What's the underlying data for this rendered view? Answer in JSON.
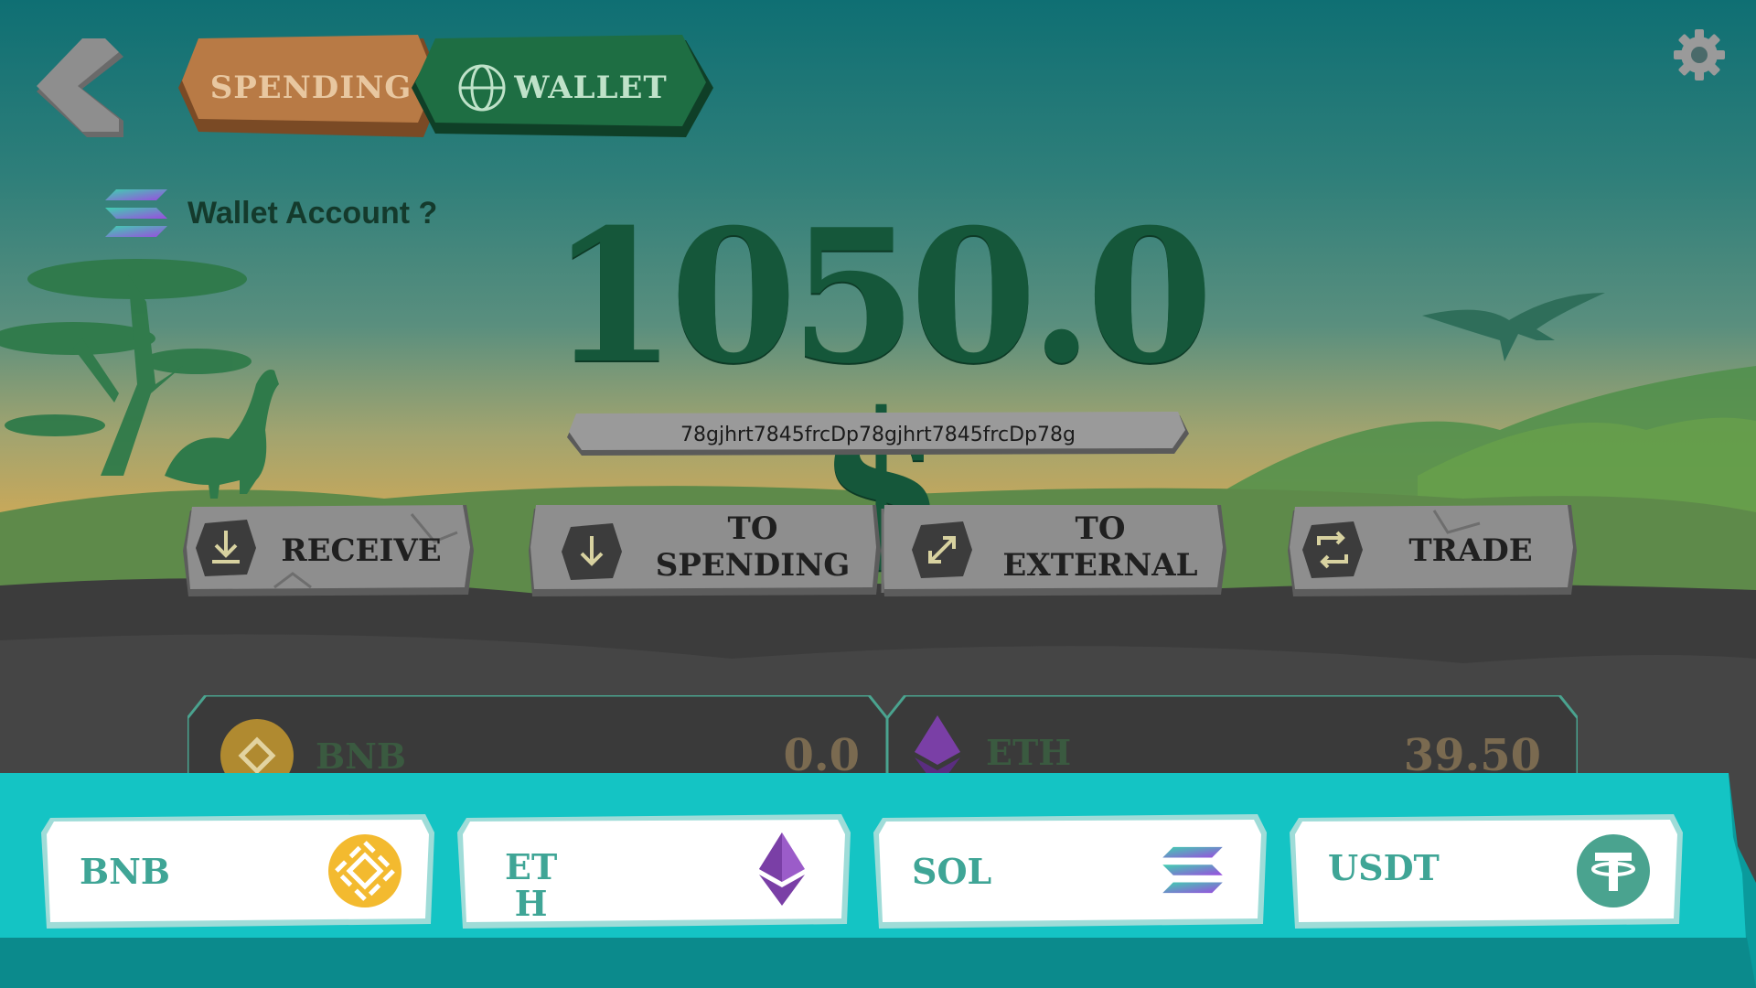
{
  "header": {
    "tabs": [
      {
        "label": "SPENDING",
        "active": false
      },
      {
        "label": "WALLET",
        "active": true
      }
    ]
  },
  "wallet": {
    "account_label": "Wallet Account ?",
    "balance": "1050.0 $",
    "address": "78gjhrt7845frcDp78gjhrt7845frcDp78g"
  },
  "actions": [
    {
      "label": "RECEIVE",
      "icon": "download-icon"
    },
    {
      "label": "TO\nSPENDING",
      "icon": "arrow-down-icon"
    },
    {
      "label": "TO\nEXTERNAL",
      "icon": "expand-icon"
    },
    {
      "label": "TRADE",
      "icon": "swap-icon"
    }
  ],
  "balances": [
    {
      "name": "BNB",
      "value": "0.0",
      "icon": "bnb-icon"
    },
    {
      "name": "ETH",
      "value": "39.50",
      "icon": "eth-icon"
    }
  ],
  "tokens": [
    {
      "label": "BNB",
      "icon": "bnb-icon"
    },
    {
      "label": "ET\nH",
      "icon": "eth-icon"
    },
    {
      "label": "SOL",
      "icon": "sol-icon"
    },
    {
      "label": "USDT",
      "icon": "usdt-icon"
    }
  ],
  "colors": {
    "accent_teal": "#14c4c4",
    "balance_green": "#15573a",
    "spending_tab": "#b87a45",
    "wallet_tab": "#1e6e43",
    "bnb_yellow": "#f3ba2f",
    "eth_purple": "#8a4fb6",
    "usdt_green": "#4aa38f"
  }
}
